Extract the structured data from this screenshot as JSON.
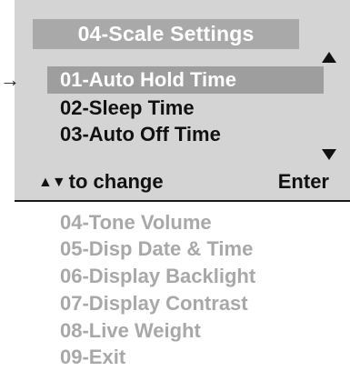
{
  "screen": {
    "title": "04-Scale Settings",
    "menu_items": [
      {
        "label": "01-Auto Hold Time",
        "selected": true
      },
      {
        "label": "02-Sleep Time",
        "selected": false
      },
      {
        "label": "03-Auto Off Time",
        "selected": false
      }
    ],
    "pointer_icon": "arrow-right-icon",
    "scroll_up_icon": "triangle-up-icon",
    "scroll_down_icon": "triangle-down-icon",
    "footer": {
      "nav_arrows": "▲▼",
      "change_label": "to change",
      "enter_label": "Enter"
    }
  },
  "offscreen_items": [
    "04-Tone Volume",
    "05-Disp Date & Time",
    "06-Display Backlight",
    "07-Display Contrast",
    "08-Live Weight",
    "09-Exit"
  ],
  "colors": {
    "screen_bg": "#d4d4d4",
    "title_bg": "#a9a9a9",
    "selected_bg": "#9e9e9e",
    "text": "#111111",
    "offscreen_text": "#a8a8a8"
  }
}
